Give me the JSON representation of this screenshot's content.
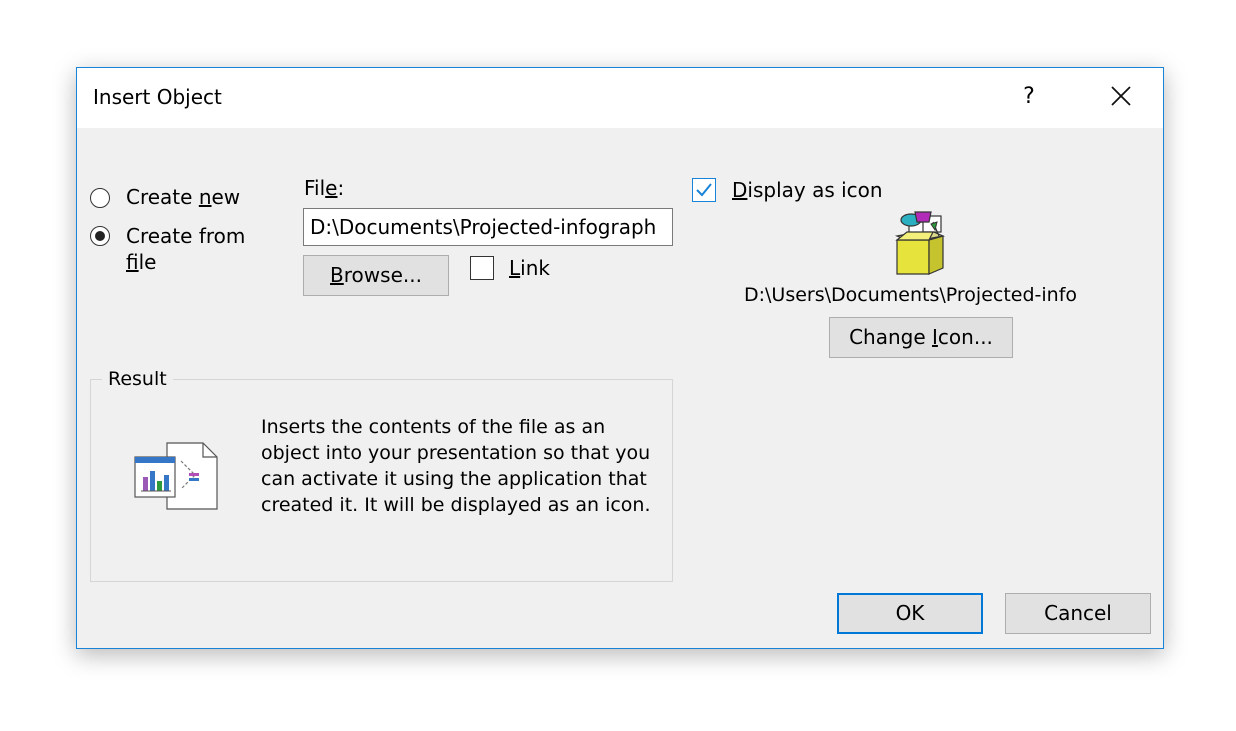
{
  "dialog": {
    "title": "Insert Object",
    "help": "?"
  },
  "options": {
    "create_new_prefix": "Create ",
    "create_new_key": "n",
    "create_new_suffix": "ew",
    "create_from_file_line1": "Create from",
    "create_from_file_key": "f",
    "create_from_file_rest": "ile",
    "selected": "create_from_file"
  },
  "file": {
    "label_prefix": "Fil",
    "label_key": "e",
    "label_suffix": ":",
    "value": "D:\\Documents\\Projected-infograph",
    "browse_key": "B",
    "browse_rest": "rowse...",
    "link_key": "L",
    "link_rest": "ink",
    "link_checked": false
  },
  "display": {
    "label_key": "D",
    "label_rest": "isplay as icon",
    "checked": true,
    "icon_name": "package-icon",
    "icon_path": "D:\\Users\\Documents\\Projected-info",
    "change_prefix": "Change ",
    "change_key": "I",
    "change_suffix": "con..."
  },
  "result": {
    "legend": "Result",
    "text": "Inserts the contents of the file as an object into your presentation so that you can activate it using the application that created it. It will be displayed as an icon.",
    "icon_name": "result-object-icon"
  },
  "buttons": {
    "ok": "OK",
    "cancel": "Cancel"
  },
  "colors": {
    "accent": "#1883d7",
    "dialog_bg": "#f0f0f0",
    "button_bg": "#e1e1e1"
  }
}
